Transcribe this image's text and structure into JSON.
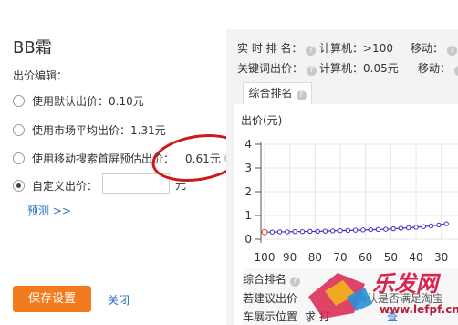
{
  "left": {
    "title": "BB霜",
    "section_label": "出价编辑：",
    "options": [
      {
        "label": "使用默认出价：0.10元"
      },
      {
        "label": "使用市场平均出价：1.31元"
      },
      {
        "label": "使用移动搜索首屏预估出价：",
        "value": "0.61元"
      },
      {
        "label": "自定义出价："
      }
    ],
    "selected_index": 3,
    "unit": "元",
    "forecast_link": "预测 >>",
    "save_button": "保存设置",
    "close_link": "关闭"
  },
  "right": {
    "rows": [
      {
        "label": "实 时 排 名：",
        "pc": "计算机：>100",
        "mobile": "移动："
      },
      {
        "label": "关键词出价：",
        "pc": "计算机：0.05元",
        "mobile": "移动："
      }
    ],
    "tab": "综合排名",
    "bottom_label": "综合排名",
    "bottom_text_1": "若建议出价",
    "bottom_text_1b": "确认是否满足淘宝",
    "bottom_text_2": "车展示位置",
    "bottom_text_2b": "求 打",
    "bottom_text_2c": "查",
    "watermark_text": "乐发网",
    "watermark_url": "www.lefpf.cn"
  },
  "chart_data": {
    "type": "line",
    "ylabel": "出价(元)",
    "x": [
      100,
      90,
      80,
      70,
      60,
      50,
      40,
      30
    ],
    "x_ticks": [
      100,
      90,
      80,
      70,
      60,
      50,
      40,
      30
    ],
    "y_ticks": [
      0,
      1,
      2,
      3,
      4
    ],
    "ylim": [
      0,
      4
    ],
    "series": [
      {
        "x": [
          100,
          97,
          94,
          91,
          88,
          85,
          82,
          79,
          76,
          73,
          70,
          67,
          64,
          61,
          58,
          55,
          52,
          49,
          46,
          43,
          40,
          37,
          34,
          31,
          28
        ],
        "values": [
          0.3,
          0.3,
          0.31,
          0.31,
          0.32,
          0.32,
          0.33,
          0.33,
          0.34,
          0.35,
          0.36,
          0.37,
          0.38,
          0.39,
          0.4,
          0.41,
          0.42,
          0.44,
          0.46,
          0.48,
          0.5,
          0.53,
          0.56,
          0.6,
          0.65
        ],
        "color": "#3a2fc2"
      }
    ],
    "highlight_color": "#e0403a"
  }
}
